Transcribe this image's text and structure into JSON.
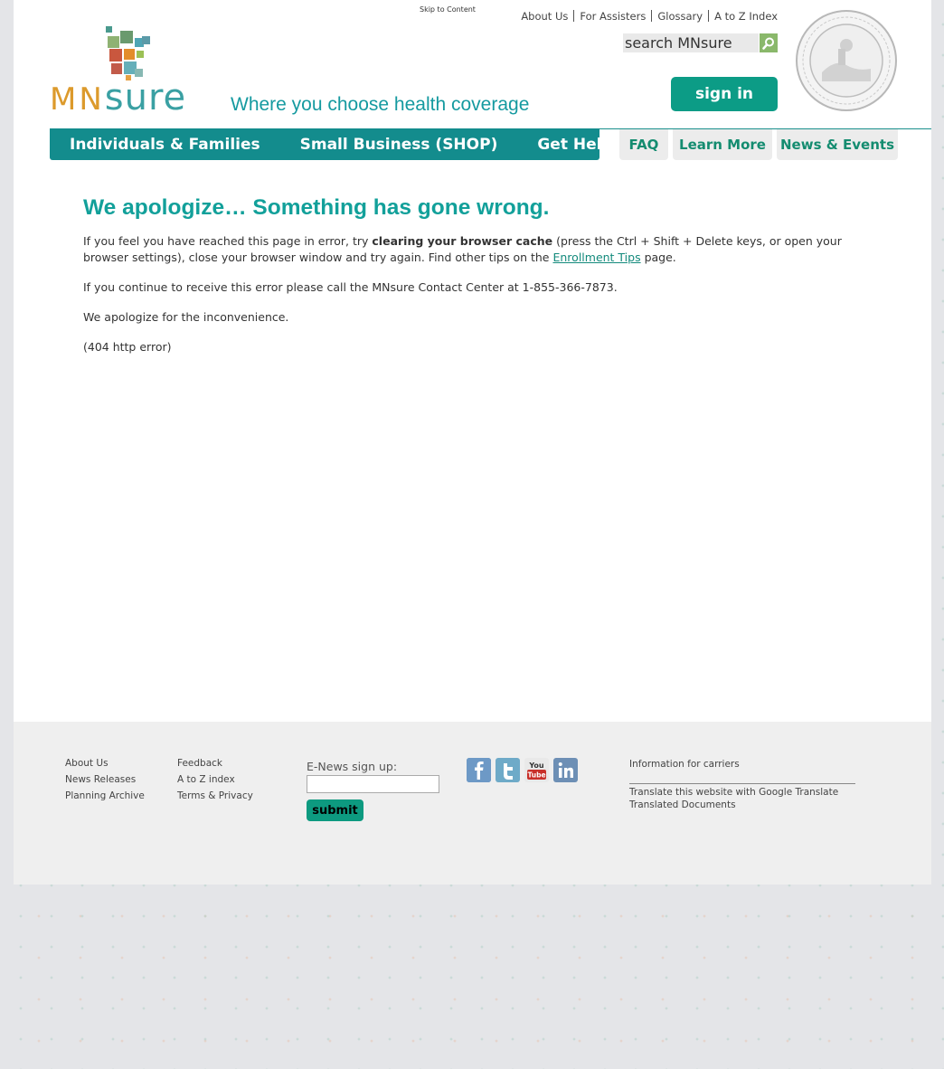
{
  "header": {
    "skip_link": "Skip to Content",
    "top_links": [
      "About Us",
      "For Assisters",
      "Glossary",
      "A to Z Index"
    ],
    "search_placeholder": "search MNsure",
    "sign_in": "sign in",
    "logo_mn": "MN",
    "logo_sure": "sure",
    "tagline": "Where you choose health coverage"
  },
  "main_nav": [
    "Individuals & Families",
    "Small Business (SHOP)",
    "Get Help"
  ],
  "sub_nav": [
    "FAQ",
    "Learn More",
    "News & Events"
  ],
  "content": {
    "title": "We apologize… Something has gone wrong.",
    "p1_before": "If you feel you have reached this page in error, try ",
    "p1_bold": "clearing your browser cache",
    "p1_after": " (press the Ctrl + Shift + Delete keys, or open your browser settings), close your browser window and try again. Find other tips on the ",
    "p1_link": "Enrollment Tips",
    "p1_end": " page.",
    "p2": "If you continue to receive this error please call the MNsure Contact Center at 1-855-366-7873.",
    "p3": "We apologize for the inconvenience.",
    "p4": "(404 http error)"
  },
  "footer": {
    "col1": [
      "About Us",
      "News Releases",
      "Planning Archive"
    ],
    "col2": [
      "Feedback",
      "A to Z index",
      "Terms & Privacy"
    ],
    "enews_label": "E-News sign up:",
    "submit": "submit",
    "social": [
      "facebook-icon",
      "twitter-icon",
      "youtube-icon",
      "linkedin-icon"
    ],
    "carriers": "Information for carriers",
    "translate_1": "Translate this website with Google Translate",
    "translate_2": "Translated Documents"
  },
  "colors": {
    "teal": "#138c8d",
    "green_button": "#0c9c86",
    "logo_orange": "#dc9a2c"
  }
}
